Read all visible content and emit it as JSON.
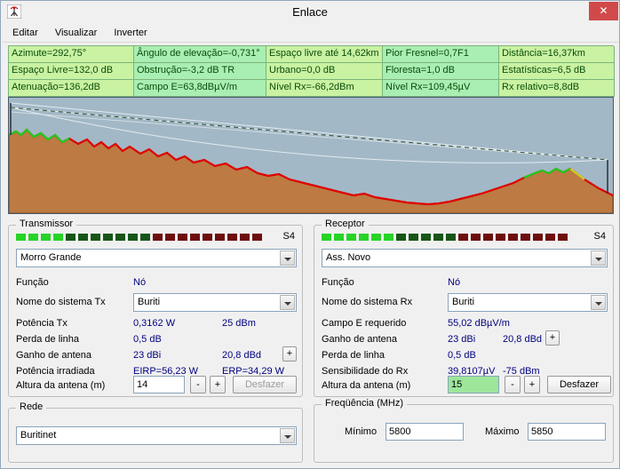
{
  "window": {
    "title": "Enlace"
  },
  "icons": {
    "close": "✕"
  },
  "menu": {
    "items": [
      "Editar",
      "Visualizar",
      "Inverter"
    ]
  },
  "link_info": {
    "rows": [
      [
        "Azimute=292,75°",
        "Ângulo de elevação=-0,731°",
        "Espaço livre até 14,62km",
        "Pior Fresnel=0,7F1",
        "Distância=16,37km"
      ],
      [
        "Espaço Livre=132,0 dB",
        "Obstrução=-3,2 dB TR",
        "Urbano=0,0 dB",
        "Floresta=1,0 dB",
        "Estatísticas=6,5 dB"
      ],
      [
        "Atenuação=136,2dB",
        "Campo E=63,8dBµV/m",
        "Nível Rx=-66,2dBm",
        "Nível Rx=109,45µV",
        "Rx relativo=8,8dB"
      ]
    ]
  },
  "transmitter": {
    "title": "Transmissor",
    "signal_label": "S4",
    "signal_bright_segments": 4,
    "site": "Morro Grande",
    "funcao_label": "Função",
    "funcao_value": "Nó",
    "system_label": "Nome do sistema Tx",
    "system_value": "Buriti",
    "power_label": "Potência Tx",
    "power_watts": "0,3162 W",
    "power_dbm": "25 dBm",
    "line_loss_label": "Perda de linha",
    "line_loss_value": "0,5 dB",
    "gain_label": "Ganho de antena",
    "gain_dbi": "23 dBi",
    "gain_dbd": "20,8 dBd",
    "gain_plus_label": "+",
    "radiated_label": "Potência irradiada",
    "radiated_eirp": "EIRP=56,23 W",
    "radiated_erp": "ERP=34,29 W",
    "height_label": "Altura da antena (m)",
    "height_value": "14",
    "minus_label": "-",
    "plus_label": "+",
    "undo_label": "Desfazer"
  },
  "receiver": {
    "title": "Receptor",
    "signal_label": "S4",
    "signal_bright_segments": 6,
    "site": "Ass. Novo",
    "funcao_label": "Função",
    "funcao_value": "Nó",
    "system_label": "Nome do sistema Rx",
    "system_value": "Buriti",
    "field_label": "Campo E requerido",
    "field_value": "55,02 dBµV/m",
    "gain_label": "Ganho de antena",
    "gain_dbi": "23 dBi",
    "gain_dbd": "20,8 dBd",
    "gain_plus_label": "+",
    "line_loss_label": "Perda de linha",
    "line_loss_value": "0,5 dB",
    "sensitivity_label": "Sensibilidade do Rx",
    "sensitivity_uv": "39,8107µV",
    "sensitivity_dbm": "-75 dBm",
    "height_label": "Altura da antena (m)",
    "height_value": "15",
    "minus_label": "-",
    "plus_label": "+",
    "undo_label": "Desfazer"
  },
  "network": {
    "title": "Rede",
    "value": "Buritinet"
  },
  "frequency": {
    "title": "Freqüência (MHz)",
    "min_label": "Mínimo",
    "min_value": "5800",
    "max_label": "Máximo",
    "max_value": "5850"
  }
}
